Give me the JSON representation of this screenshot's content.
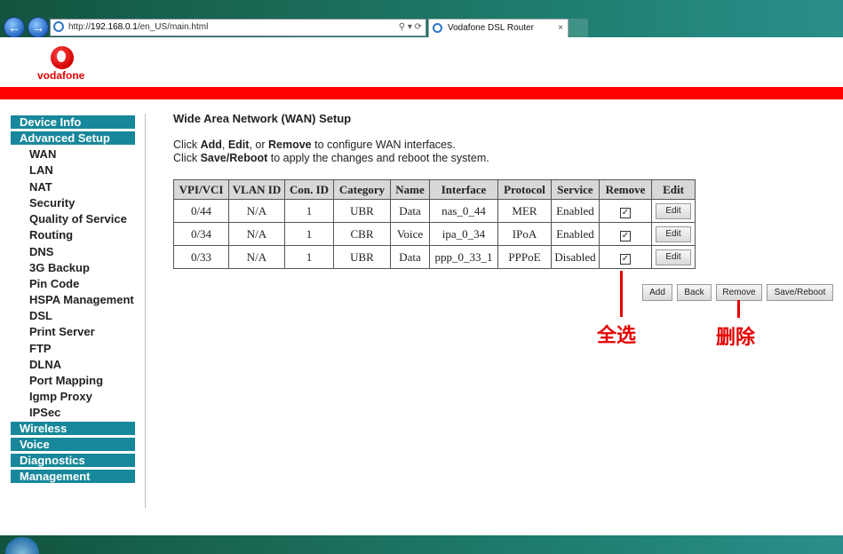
{
  "browser": {
    "address_prefix": "http://",
    "address_host": "192.168.0.1",
    "address_path": "/en_US/main.html",
    "address_tools": "⚲ ▾ ⟳",
    "tab_title": "Vodafone DSL Router",
    "tab_close": "×"
  },
  "brand": {
    "logo_text": "vodafone",
    "accent_color": "#ff0000",
    "menu_color": "#17879b"
  },
  "sidebar": {
    "groups": {
      "device_info": "Device Info",
      "advanced_setup": "Advanced Setup",
      "wireless": "Wireless",
      "voice": "Voice",
      "diagnostics": "Diagnostics",
      "management": "Management"
    },
    "sub": [
      "WAN",
      "LAN",
      "NAT",
      "Security",
      "Quality of Service",
      "Routing",
      "DNS",
      "3G Backup",
      "Pin Code",
      "HSPA Management",
      "DSL",
      "Print Server",
      "FTP",
      "DLNA",
      "Port Mapping",
      "Igmp Proxy",
      "IPSec"
    ]
  },
  "main": {
    "title": "Wide Area Network (WAN) Setup",
    "line1": [
      "Click ",
      "Add",
      ", ",
      "Edit",
      ", or ",
      "Remove",
      " to configure WAN interfaces."
    ],
    "line2": [
      "Click ",
      "Save/Reboot",
      " to apply the changes and reboot the system."
    ],
    "headers": [
      "VPI/VCI",
      "VLAN ID",
      "Con. ID",
      "Category",
      "Name",
      "Interface",
      "Protocol",
      "Service",
      "Remove",
      "Edit"
    ],
    "rows": [
      [
        "0/44",
        "N/A",
        "1",
        "UBR",
        "Data",
        "nas_0_44",
        "MER",
        "Enabled"
      ],
      [
        "0/34",
        "N/A",
        "1",
        "CBR",
        "Voice",
        "ipa_0_34",
        "IPoA",
        "Enabled"
      ],
      [
        "0/33",
        "N/A",
        "1",
        "UBR",
        "Data",
        "ppp_0_33_1",
        "PPPoE",
        "Disabled"
      ]
    ],
    "remove_checked": [
      "✓",
      "✓",
      "✓"
    ],
    "edit_label": "Edit",
    "actions": {
      "add": "Add",
      "back": "Back",
      "remove": "Remove",
      "save_reboot": "Save/Reboot"
    }
  },
  "annotations": {
    "select_all": "全选",
    "delete": "删除"
  }
}
